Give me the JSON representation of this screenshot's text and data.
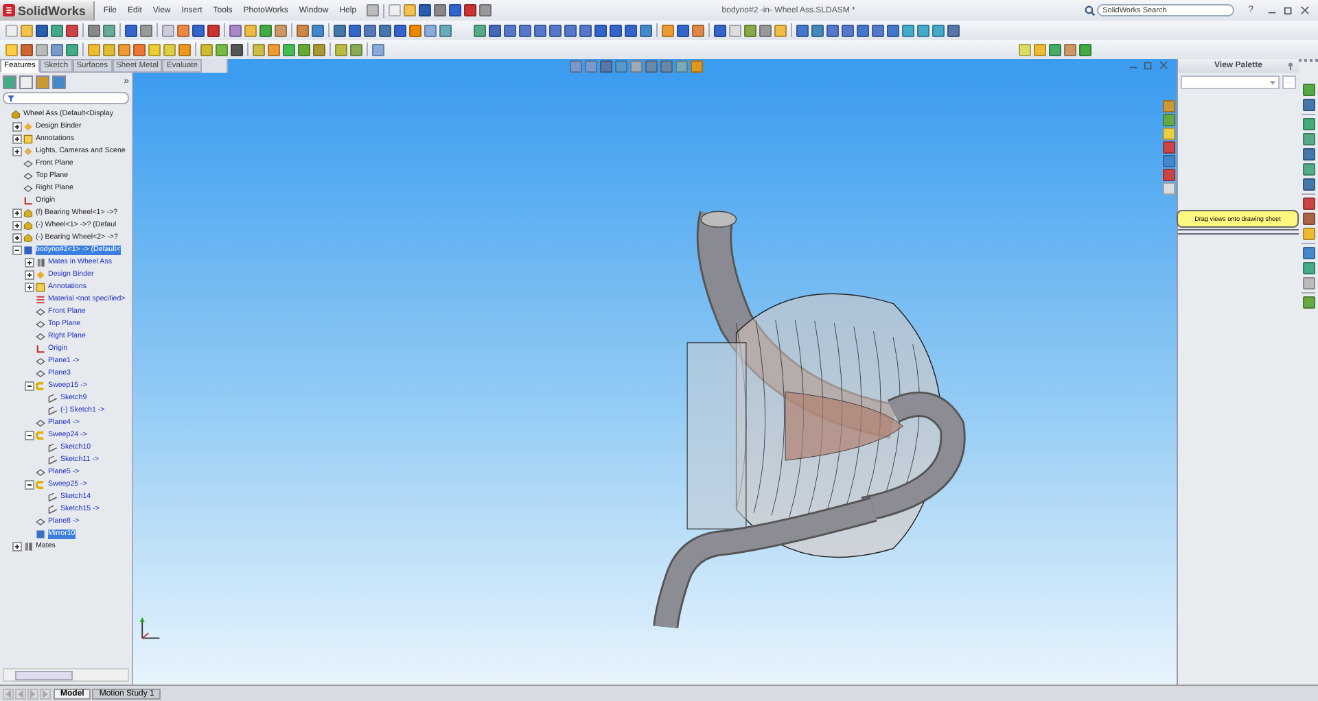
{
  "window": {
    "title": "bodyno#2 -in- Wheel Ass.SLDASM *",
    "logo": "SolidWorks"
  },
  "menu": [
    "File",
    "Edit",
    "View",
    "Insert",
    "Tools",
    "PhotoWorks",
    "Window",
    "Help"
  ],
  "search": {
    "placeholder": "SolidWorks Search"
  },
  "help_glyph": "?",
  "command_tabs": [
    {
      "label": "Features",
      "selected": true
    },
    {
      "label": "Sketch",
      "selected": false
    },
    {
      "label": "Surfaces",
      "selected": false
    },
    {
      "label": "Sheet Metal",
      "selected": false
    },
    {
      "label": "Evaluate",
      "selected": false
    }
  ],
  "panel_more": "»",
  "tree": [
    {
      "label": "Wheel Ass  (Default<Display",
      "kind": "assembly",
      "selected": false,
      "children": [
        {
          "label": "Design Binder",
          "kind": "binder",
          "expanded": false,
          "selected": false
        },
        {
          "label": "Annotations",
          "kind": "annotation",
          "expanded": false,
          "selected": false
        },
        {
          "label": "Lights, Cameras and Scene",
          "kind": "lights",
          "expanded": false,
          "selected": false
        },
        {
          "label": "Front Plane",
          "kind": "plane",
          "selected": false
        },
        {
          "label": "Top Plane",
          "kind": "plane",
          "selected": false
        },
        {
          "label": "Right Plane",
          "kind": "plane",
          "selected": false
        },
        {
          "label": "Origin",
          "kind": "origin",
          "selected": false
        },
        {
          "label": "(f) Bearing Wheel<1> ->?",
          "kind": "part",
          "expanded": false,
          "selected": false
        },
        {
          "label": "(-) Wheel<1> ->? (Defaul",
          "kind": "part",
          "expanded": false,
          "selected": false
        },
        {
          "label": "(-) Bearing Wheel<2> ->?",
          "kind": "part",
          "expanded": false,
          "selected": false
        },
        {
          "label": "bodyno#2<1> -> (Default<",
          "kind": "body",
          "expanded": true,
          "selected": true,
          "children": [
            {
              "label": "Mates in Wheel Ass",
              "kind": "mates",
              "expanded": false,
              "selected": false
            },
            {
              "label": "Design Binder",
              "kind": "binder",
              "expanded": false,
              "selected": false
            },
            {
              "label": "Annotations",
              "kind": "annotation",
              "expanded": false,
              "selected": false
            },
            {
              "label": "Material <not specified>",
              "kind": "material",
              "selected": false
            },
            {
              "label": "Front Plane",
              "kind": "plane",
              "selected": false
            },
            {
              "label": "Top Plane",
              "kind": "plane",
              "selected": false
            },
            {
              "label": "Right Plane",
              "kind": "plane",
              "selected": false
            },
            {
              "label": "Origin",
              "kind": "origin",
              "selected": false
            },
            {
              "label": "Plane1  ->",
              "kind": "plane",
              "selected": false
            },
            {
              "label": "Plane3",
              "kind": "plane",
              "selected": false
            },
            {
              "label": "Sweep15  ->",
              "kind": "sweep",
              "expanded": true,
              "selected": false,
              "children": [
                {
                  "label": "Sketch9",
                  "kind": "sketch",
                  "selected": false
                },
                {
                  "label": "(-) Sketch1  ->",
                  "kind": "sketch",
                  "selected": false
                }
              ]
            },
            {
              "label": "Plane4  ->",
              "kind": "plane",
              "selected": false
            },
            {
              "label": "Sweep24  ->",
              "kind": "sweep",
              "expanded": true,
              "selected": false,
              "children": [
                {
                  "label": "Sketch10",
                  "kind": "sketch",
                  "selected": false
                },
                {
                  "label": "Sketch11  ->",
                  "kind": "sketch",
                  "selected": false
                }
              ]
            },
            {
              "label": "Plane5  ->",
              "kind": "plane",
              "selected": false
            },
            {
              "label": "Sweep25  ->",
              "kind": "sweep",
              "expanded": true,
              "selected": false,
              "children": [
                {
                  "label": "Sketch14",
                  "kind": "sketch",
                  "selected": false
                },
                {
                  "label": "Sketch15  ->",
                  "kind": "sketch",
                  "selected": false
                }
              ]
            },
            {
              "label": "Plane8  ->",
              "kind": "plane",
              "selected": false
            },
            {
              "label": "Mirror10",
              "kind": "mirror",
              "selected": true
            }
          ]
        },
        {
          "label": "Mates",
          "kind": "mates",
          "expanded": false,
          "selected": false
        }
      ]
    }
  ],
  "view_palette": {
    "title": "View Palette",
    "browse": "...",
    "hint": "Drag views onto drawing sheet"
  },
  "bottom_tabs": [
    {
      "label": "Model",
      "selected": true
    },
    {
      "label": "Motion Study 1",
      "selected": false
    }
  ]
}
